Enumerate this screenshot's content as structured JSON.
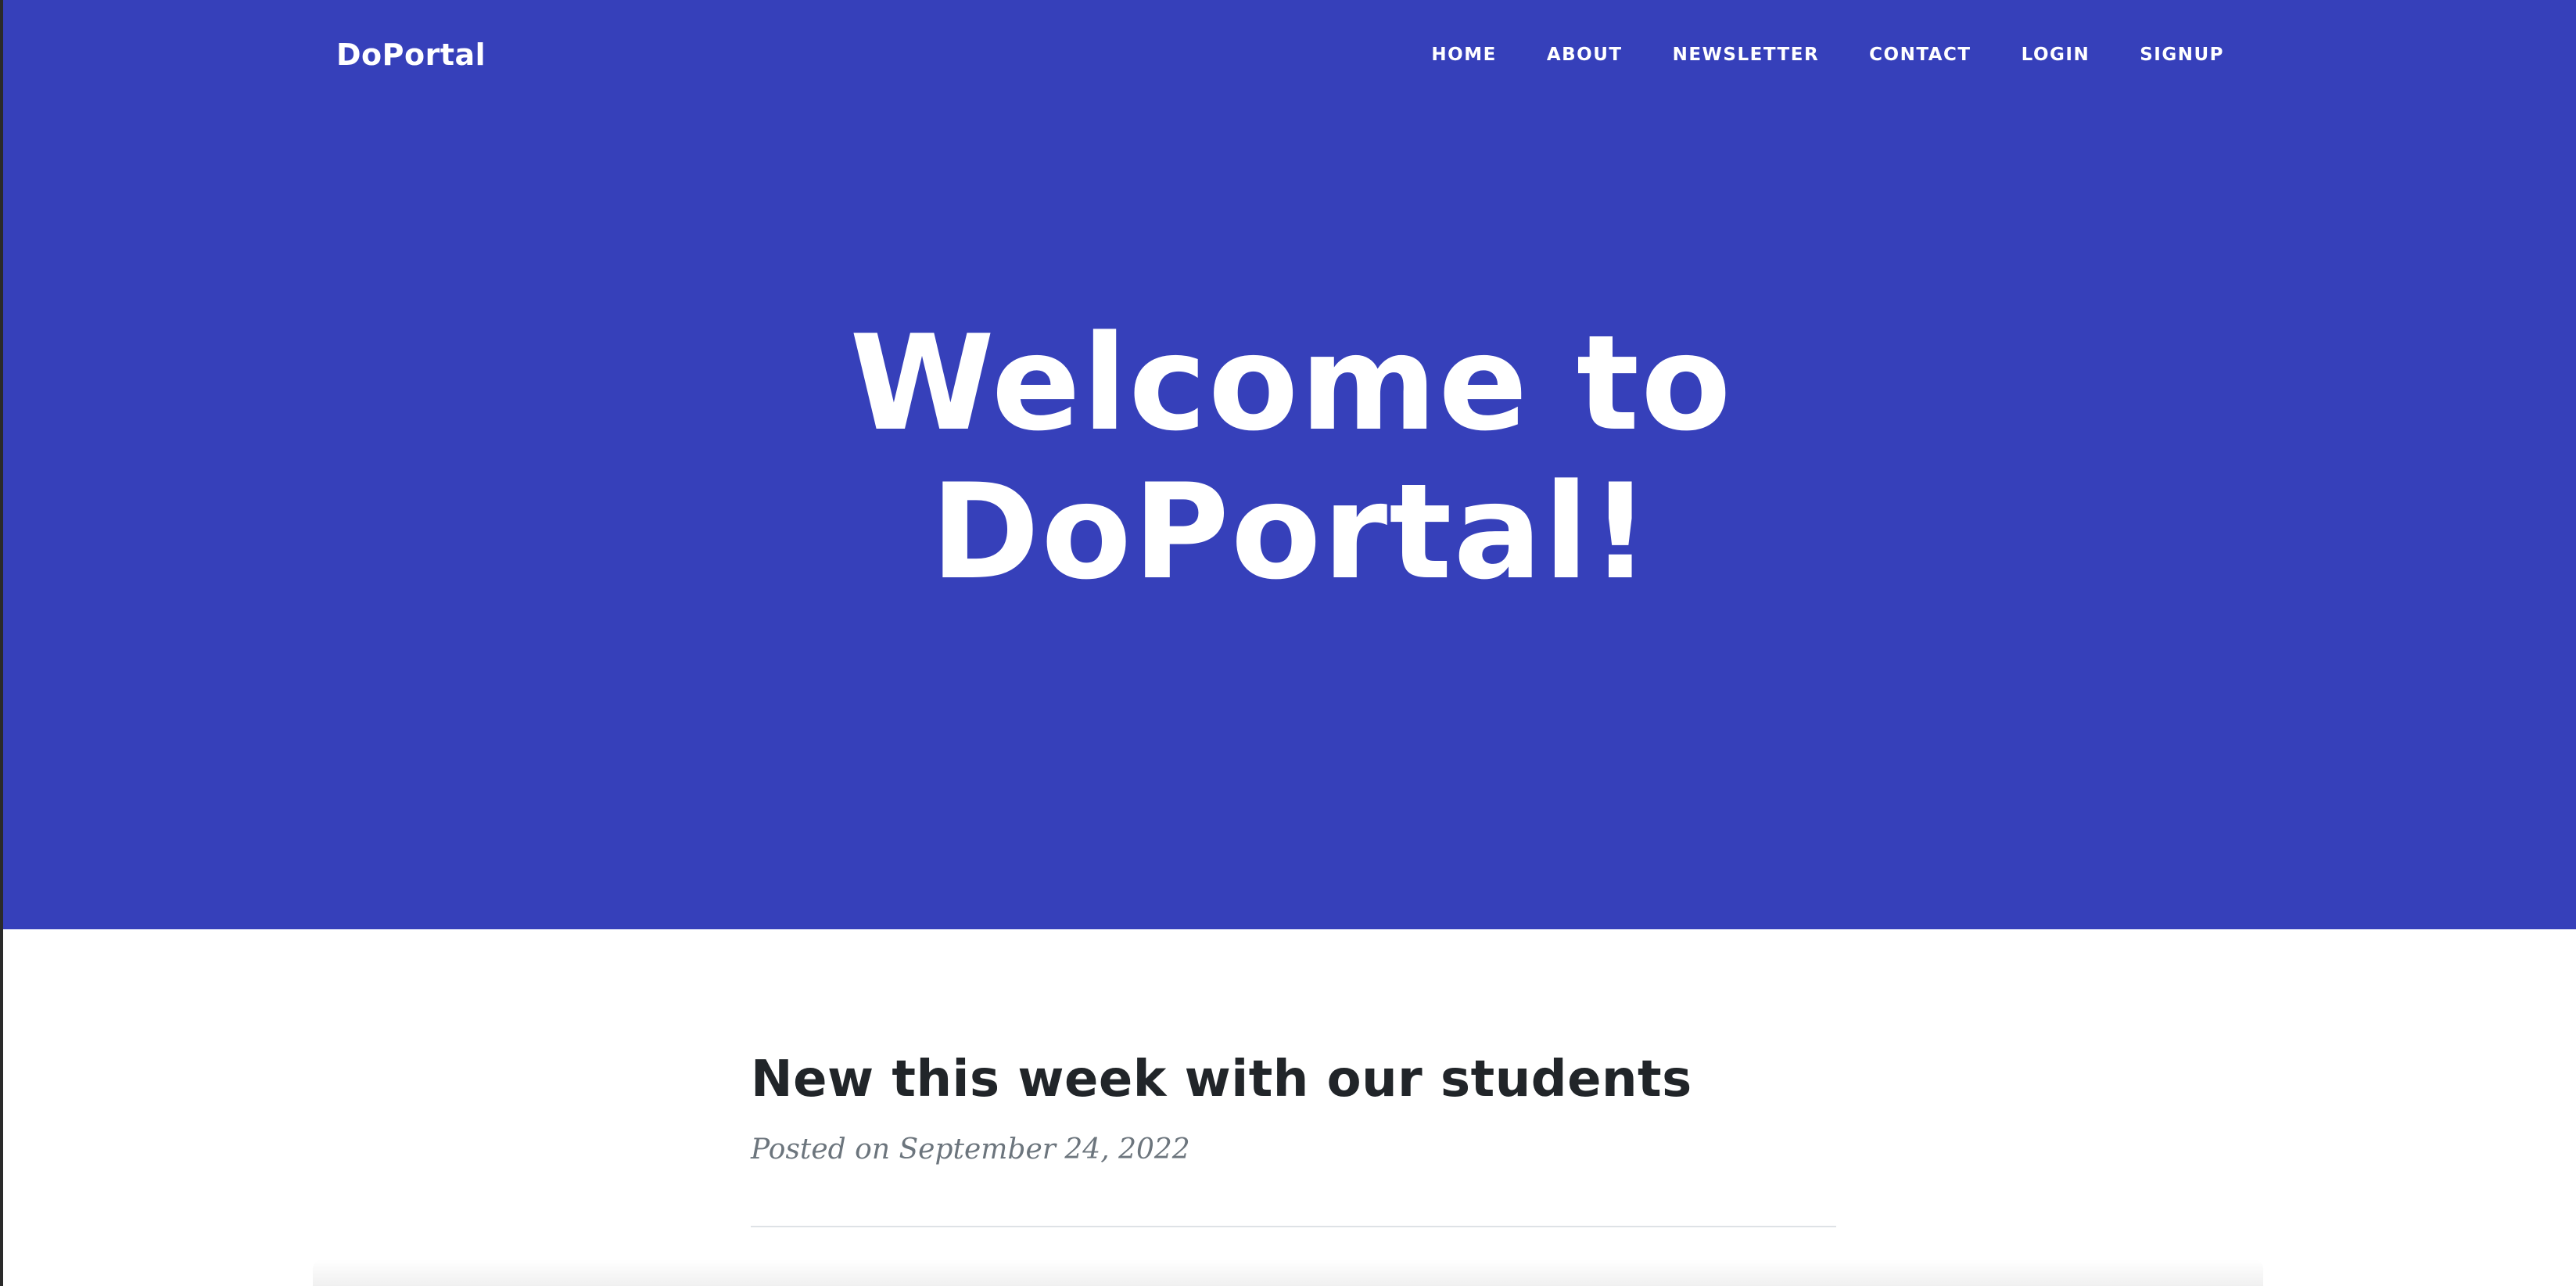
{
  "navbar": {
    "brand": "DoPortal",
    "links": [
      {
        "label": "HOME"
      },
      {
        "label": "ABOUT"
      },
      {
        "label": "NEWSLETTER"
      },
      {
        "label": "CONTACT"
      },
      {
        "label": "LOGIN"
      },
      {
        "label": "SIGNUP"
      }
    ]
  },
  "hero": {
    "title_line1": "Welcome to",
    "title_line2": "DoPortal!"
  },
  "post": {
    "title": "New this week with our students",
    "meta": "Posted on September 24, 2022"
  },
  "colors": {
    "hero_background": "#3640ba",
    "text_light": "#ffffff",
    "text_dark": "#212529",
    "text_muted": "#6c757d",
    "divider": "#dee2e6"
  }
}
